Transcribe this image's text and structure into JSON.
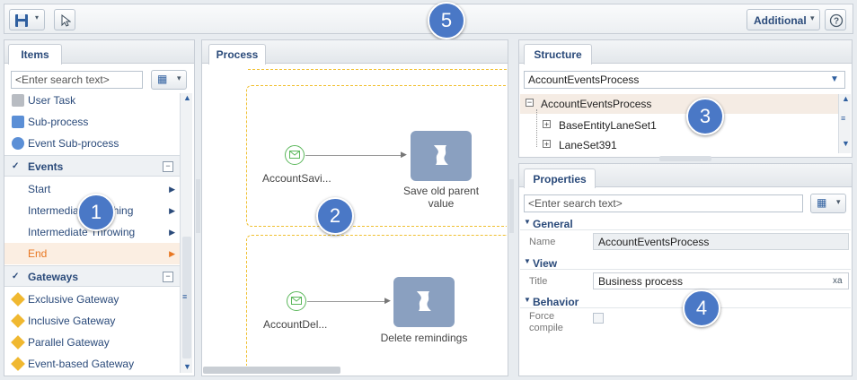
{
  "toolbar": {
    "additional_label": "Additional",
    "help_icon": "help-icon",
    "save_icon": "floppy-disk-icon",
    "pointer_icon": "cursor-pointer-icon"
  },
  "items_panel": {
    "tab_label": "Items",
    "search_placeholder": "<Enter search text>",
    "top_items": [
      {
        "label": "User Task",
        "icon": "user-task-icon"
      },
      {
        "label": "Sub-process",
        "icon": "sub-process-icon"
      },
      {
        "label": "Event Sub-process",
        "icon": "event-sub-process-icon"
      }
    ],
    "events_group": {
      "label": "Events",
      "items": [
        {
          "label": "Start"
        },
        {
          "label": "Intermediate Catching"
        },
        {
          "label": "Intermediate Throwing"
        },
        {
          "label": "End"
        }
      ]
    },
    "gateways_group": {
      "label": "Gateways",
      "items": [
        {
          "label": "Exclusive Gateway"
        },
        {
          "label": "Inclusive Gateway"
        },
        {
          "label": "Parallel Gateway"
        },
        {
          "label": "Event-based Gateway"
        }
      ]
    }
  },
  "process_panel": {
    "tab_label": "Process",
    "flow1": {
      "event_label": "AccountSavi...",
      "task_label_line1": "Save old parent",
      "task_label_line2": "value"
    },
    "flow2": {
      "event_label": "AccountDel...",
      "task_label": "Delete remindings"
    }
  },
  "structure_panel": {
    "tab_label": "Structure",
    "selected_process": "AccountEventsProcess",
    "tree": {
      "root": "AccountEventsProcess",
      "children": [
        "BaseEntityLaneSet1",
        "LaneSet391"
      ]
    }
  },
  "properties_panel": {
    "tab_label": "Properties",
    "search_placeholder": "<Enter search text>",
    "general": {
      "label": "General",
      "name_label": "Name",
      "name_value": "AccountEventsProcess"
    },
    "view": {
      "label": "View",
      "title_label": "Title",
      "title_value": "Business process"
    },
    "behavior": {
      "label": "Behavior",
      "force_compile_line1": "Force",
      "force_compile_line2": "compile"
    }
  },
  "callouts": {
    "c1": "1",
    "c2": "2",
    "c3": "3",
    "c4": "4",
    "c5": "5"
  },
  "colors": {
    "accent": "#4a78c6",
    "selected_item": "#e87722",
    "task_block": "#8aa0c0",
    "dashed_border": "#f0c030",
    "event_green": "#5cb85c"
  }
}
